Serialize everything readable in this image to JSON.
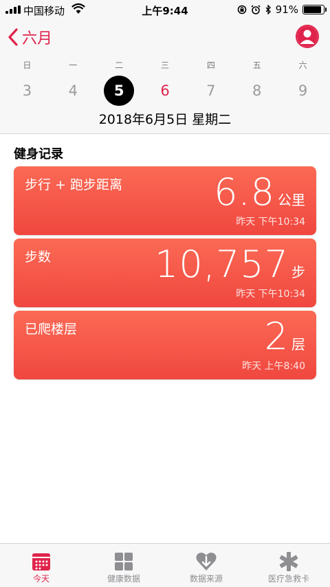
{
  "status_bar": {
    "carrier": "中国移动",
    "time": "上午9:44",
    "battery": "91%",
    "battery_level": 0.91
  },
  "nav": {
    "back_label": "六月"
  },
  "calendar": {
    "weekdays": [
      "日",
      "一",
      "二",
      "三",
      "四",
      "五",
      "六"
    ],
    "dates": [
      "3",
      "4",
      "5",
      "6",
      "7",
      "8",
      "9"
    ],
    "selected_index": 2,
    "today_index": 3,
    "full_date": "2018年6月5日 星期二"
  },
  "section_title": "健身记录",
  "cards": [
    {
      "label": "步行 + 跑步距离",
      "value": "6.8",
      "unit": "公里",
      "timestamp": "昨天 下午10:34"
    },
    {
      "label": "步数",
      "value": "10,757",
      "unit": "步",
      "timestamp": "昨天 下午10:34"
    },
    {
      "label": "已爬楼层",
      "value": "2",
      "unit": "层",
      "timestamp": "昨天 上午8:40"
    }
  ],
  "tabs": [
    {
      "label": "今天",
      "icon": "calendar-icon",
      "active": true
    },
    {
      "label": "健康数据",
      "icon": "grid-icon",
      "active": false
    },
    {
      "label": "数据来源",
      "icon": "heart-download-icon",
      "active": false
    },
    {
      "label": "医疗急救卡",
      "icon": "medical-star-icon",
      "active": false
    }
  ],
  "colors": {
    "accent": "#e0234b",
    "card_top": "#fb6a55",
    "card_bottom": "#f0473f"
  }
}
